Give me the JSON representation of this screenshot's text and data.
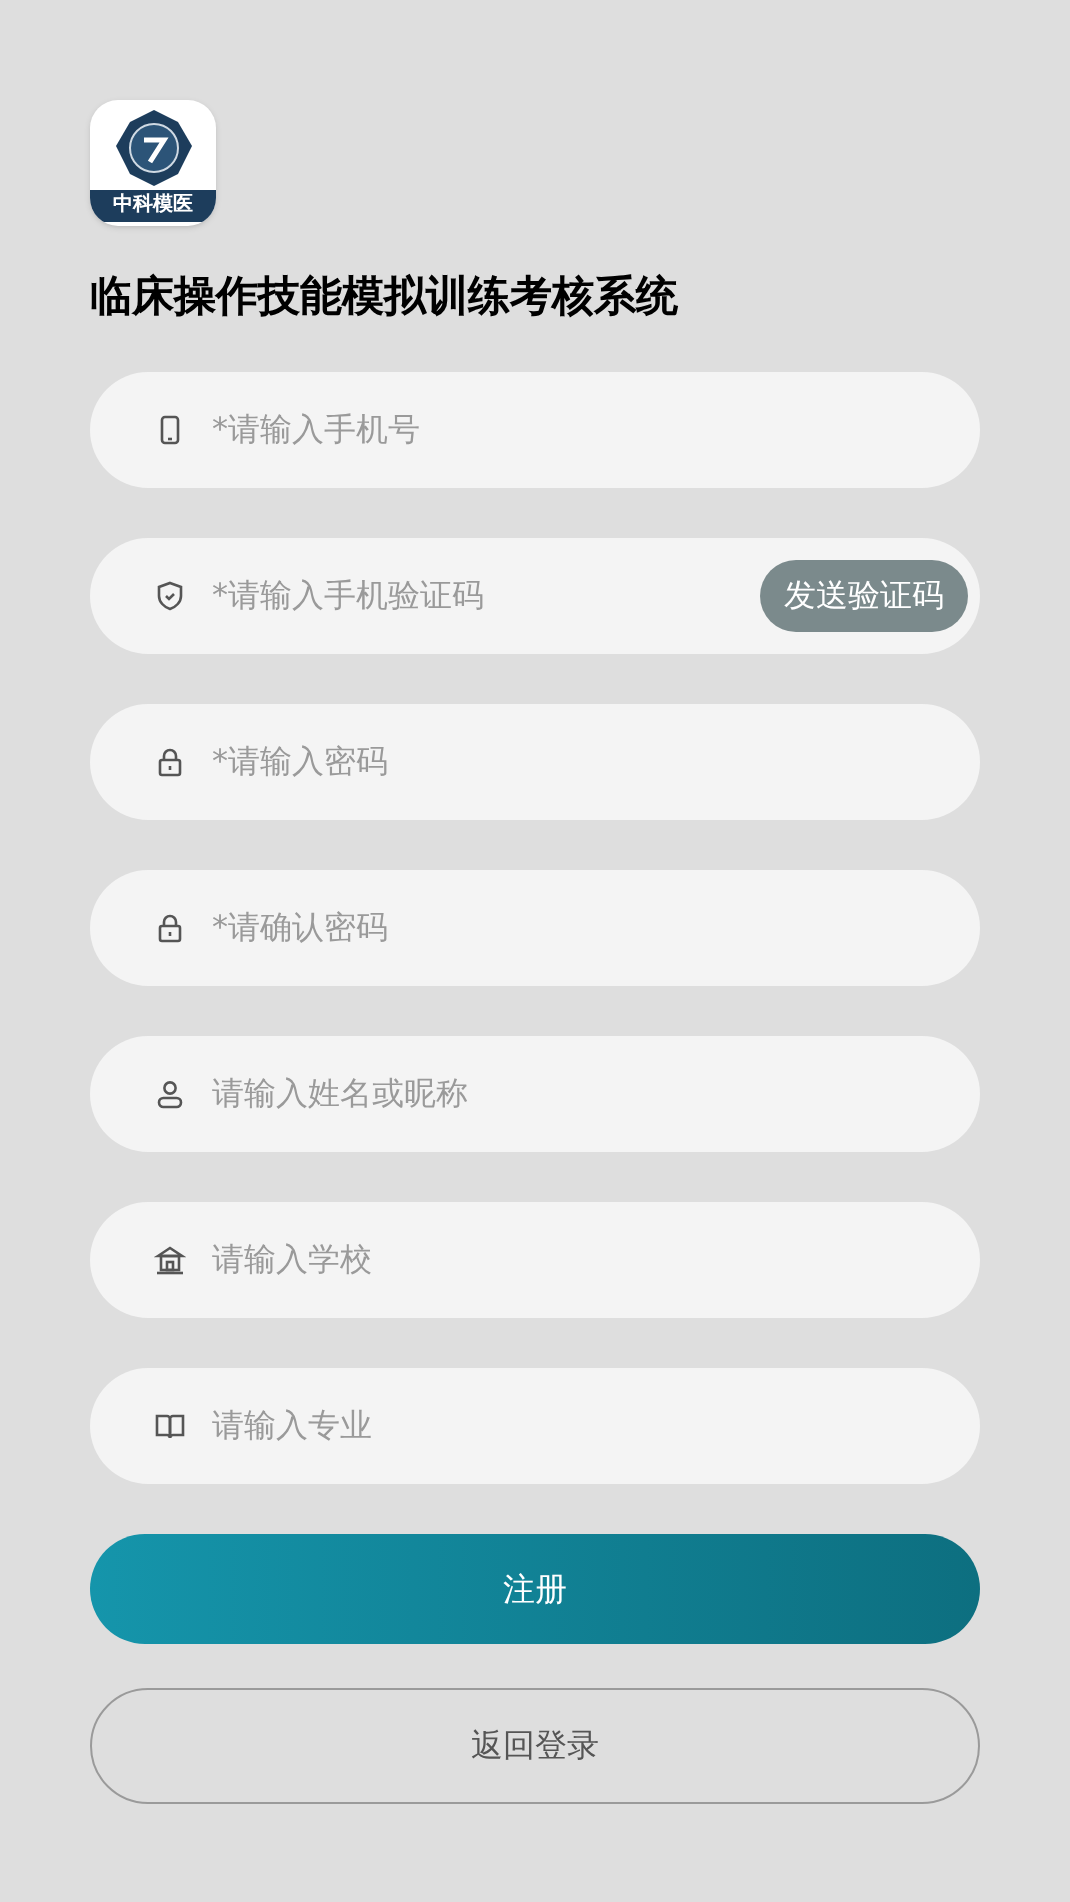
{
  "logo": {
    "caption": "中科模医"
  },
  "title": "临床操作技能模拟训练考核系统",
  "fields": [
    {
      "kind": "phone",
      "placeholder": "*请输入手机号"
    },
    {
      "kind": "shield",
      "placeholder": "*请输入手机验证码",
      "action": "发送验证码"
    },
    {
      "kind": "password",
      "placeholder": "*请输入密码"
    },
    {
      "kind": "password",
      "placeholder": "*请确认密码"
    },
    {
      "kind": "user",
      "placeholder": "请输入姓名或昵称"
    },
    {
      "kind": "school",
      "placeholder": "请输入学校"
    },
    {
      "kind": "major",
      "placeholder": "请输入专业"
    }
  ],
  "register_button": "注册",
  "back_button": "返回登录"
}
